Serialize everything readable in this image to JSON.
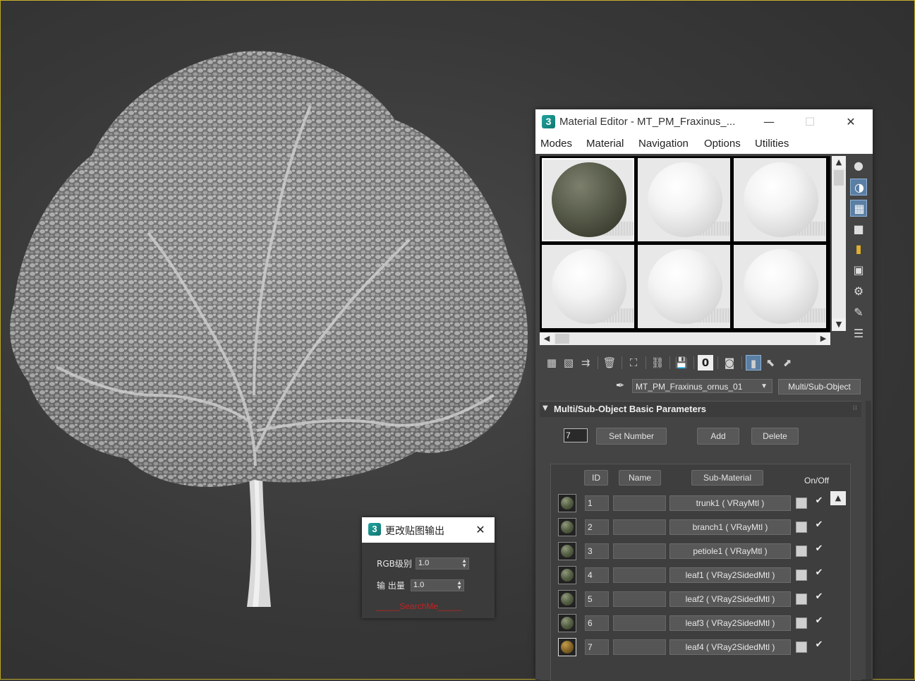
{
  "material_editor": {
    "title": "Material Editor - MT_PM_Fraxinus_...",
    "logo_text": "3",
    "window_controls": {
      "minimize": "—",
      "maximize": "☐",
      "close": "✕"
    },
    "menu": [
      "Modes",
      "Material",
      "Navigation",
      "Options",
      "Utilities"
    ],
    "material_name": "MT_PM_Fraxinus_ornus_01",
    "material_type": "Multi/Sub-Object",
    "rollout_title": "Multi/Sub-Object Basic Parameters",
    "set_number_value": "7",
    "buttons": {
      "set_number": "Set Number",
      "add": "Add",
      "delete": "Delete"
    },
    "columns": {
      "id": "ID",
      "name": "Name",
      "sub_material": "Sub-Material",
      "on_off": "On/Off"
    },
    "sub_materials": [
      {
        "id": "1",
        "name": "",
        "material": "trunk1  ( VRayMtl )",
        "enabled": "✔"
      },
      {
        "id": "2",
        "name": "",
        "material": "branch1  ( VRayMtl )",
        "enabled": "✔"
      },
      {
        "id": "3",
        "name": "",
        "material": "petiole1  ( VRayMtl )",
        "enabled": "✔"
      },
      {
        "id": "4",
        "name": "",
        "material": "leaf1  ( VRay2SidedMtl )",
        "enabled": "✔"
      },
      {
        "id": "5",
        "name": "",
        "material": "leaf2  ( VRay2SidedMtl )",
        "enabled": "✔"
      },
      {
        "id": "6",
        "name": "",
        "material": "leaf3  ( VRay2SidedMtl )",
        "enabled": "✔"
      },
      {
        "id": "7",
        "name": "",
        "material": "leaf4  ( VRay2SidedMtl )",
        "enabled": "✔"
      }
    ],
    "icons": {
      "scroll_up": "▲",
      "scroll_down": "▼",
      "scroll_left": "◀",
      "scroll_right": "▶",
      "dropdown": "▼",
      "rollout_toggle": "▼"
    }
  },
  "dialog": {
    "title": "更改贴图输出",
    "logo_text": "3",
    "close": "✕",
    "rgb_level_label": "RGB级别",
    "rgb_level_value": "1.0",
    "output_amount_label": "输 出量",
    "output_amount_value": "1.0",
    "link_text": "_____SearchMe_____"
  },
  "colors": {
    "viewport_frame": "#c8b02c",
    "ui_dark": "#444444",
    "accent_active": "#5b7fa3",
    "link_red": "#c42222"
  }
}
